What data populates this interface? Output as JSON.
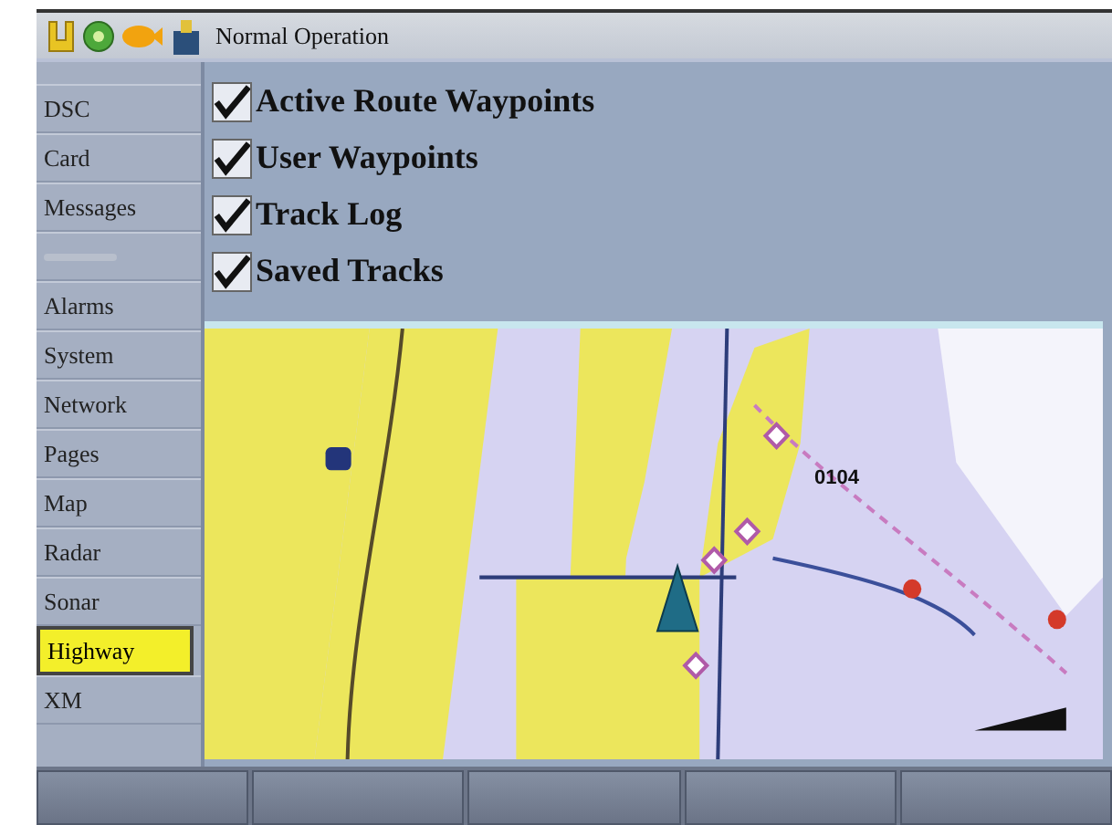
{
  "title": "Normal Operation",
  "menu": [
    {
      "label": "DSC",
      "selected": false
    },
    {
      "label": "Card",
      "selected": false
    },
    {
      "label": "Messages",
      "selected": false
    },
    {
      "kind": "blank"
    },
    {
      "label": "Alarms",
      "selected": false
    },
    {
      "label": "System",
      "selected": false
    },
    {
      "label": "Network",
      "selected": false
    },
    {
      "label": "Pages",
      "selected": false
    },
    {
      "label": "Map",
      "selected": false
    },
    {
      "label": "Radar",
      "selected": false
    },
    {
      "label": "Sonar",
      "selected": false
    },
    {
      "label": "Highway",
      "selected": true
    },
    {
      "label": "XM",
      "selected": false
    }
  ],
  "layers": [
    {
      "label": "Active Route Waypoints",
      "checked": true
    },
    {
      "label": "User Waypoints",
      "checked": true
    },
    {
      "label": "Track Log",
      "checked": true
    },
    {
      "label": "Saved Tracks",
      "checked": true
    }
  ],
  "map": {
    "labels": [
      "0104"
    ]
  }
}
